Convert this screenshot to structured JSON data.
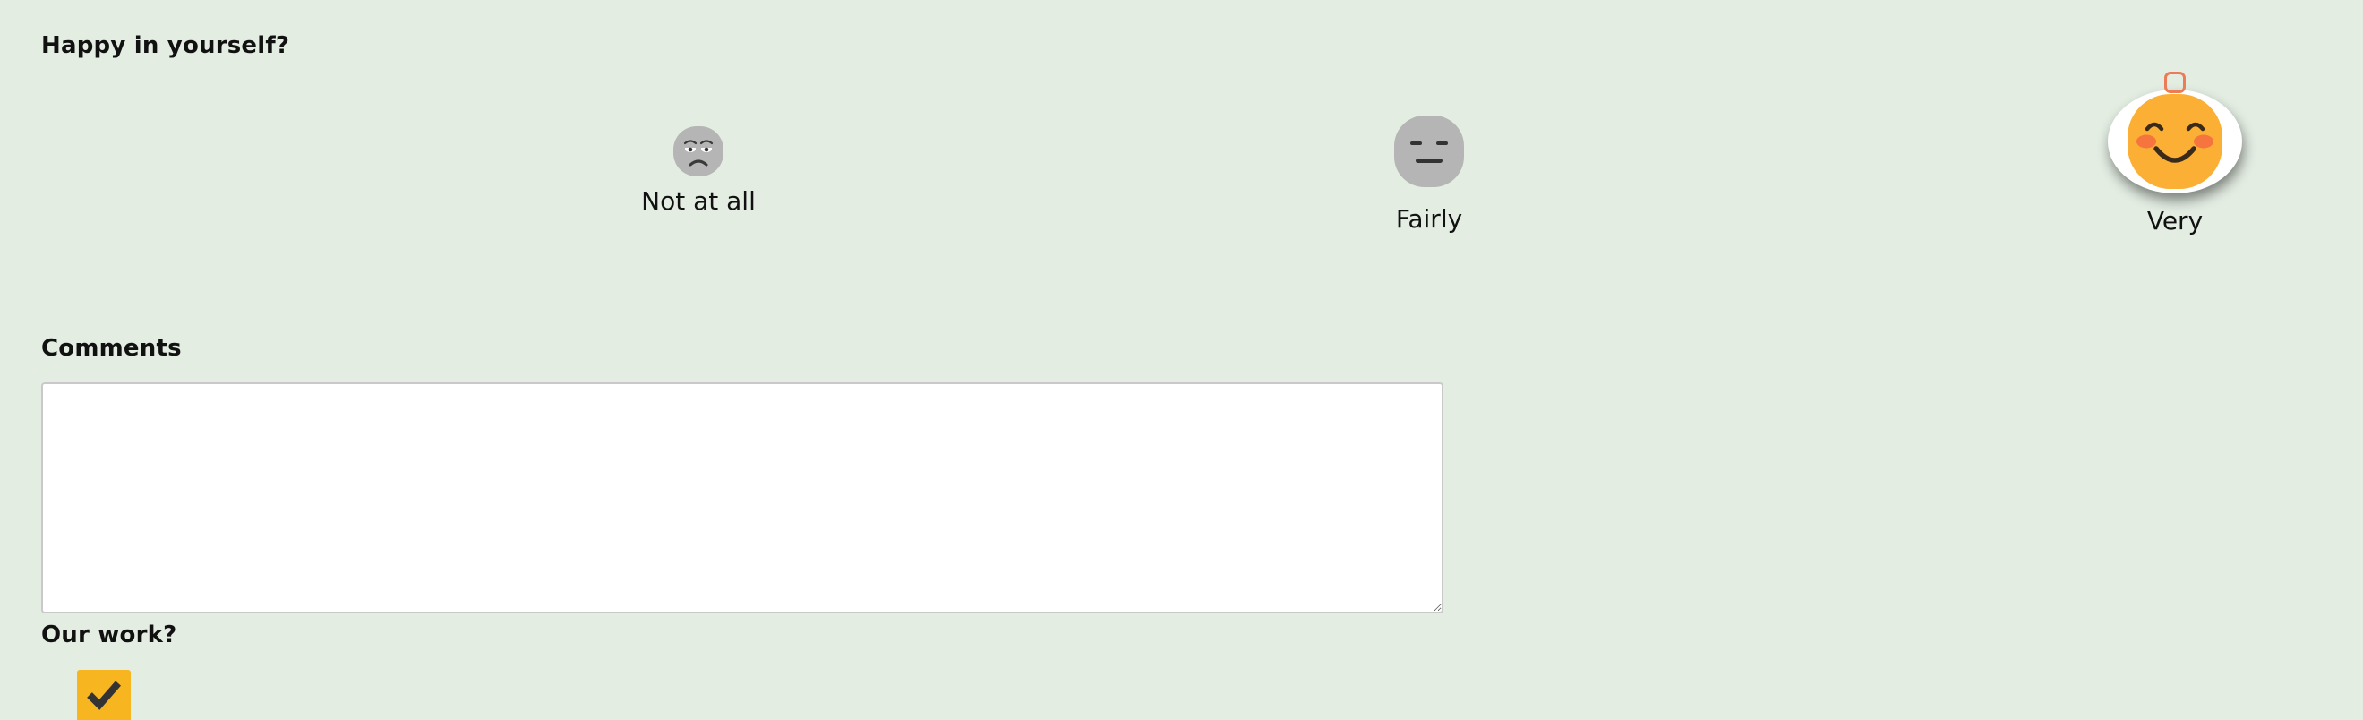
{
  "questions": {
    "happy": {
      "title": "Happy in yourself?",
      "options": [
        {
          "label": "Not at all",
          "selected": false
        },
        {
          "label": "Fairly",
          "selected": false
        },
        {
          "label": "Very",
          "selected": true
        }
      ]
    },
    "comments": {
      "title": "Comments",
      "value": "",
      "placeholder": ""
    },
    "our_work": {
      "title": "Our work?",
      "checked": true
    }
  },
  "colors": {
    "background": "#e3ede2",
    "face_gray": "#b5b5b5",
    "face_selected": "#fbb035",
    "cheek": "#f6743d",
    "radio_accent": "#ec7c55",
    "checkbox": "#f7b520"
  },
  "icons": {
    "not_at_all": "sad-face-icon",
    "fairly": "neutral-face-icon",
    "very": "smiling-face-icon",
    "check": "checkmark-icon"
  }
}
